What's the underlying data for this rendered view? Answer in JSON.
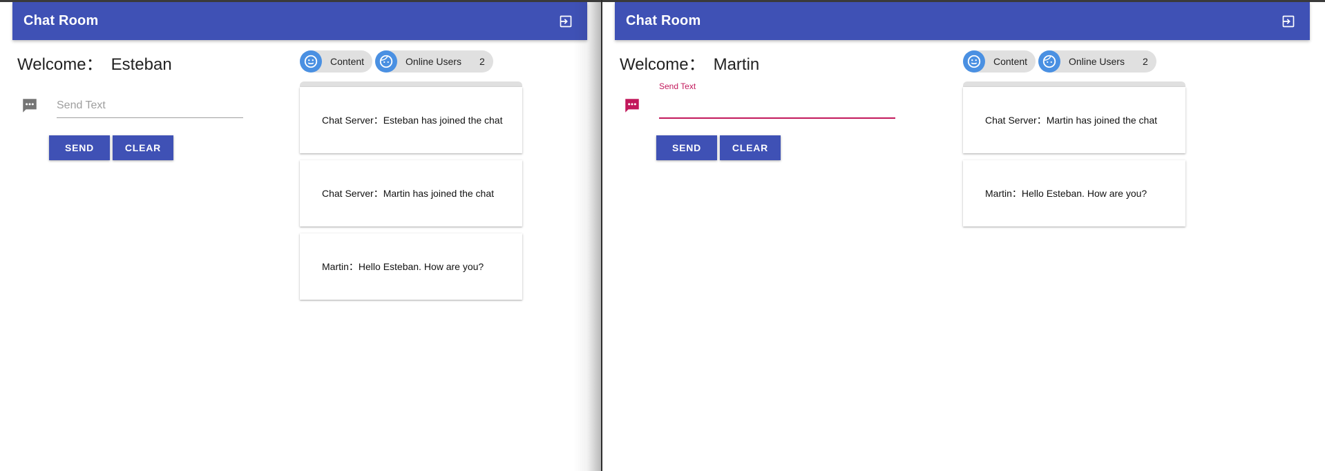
{
  "theme": {
    "primary": "#3f51b5",
    "accent": "#c2185b",
    "chip_bg": "#e0e0e0",
    "avatar": "#4a90e2"
  },
  "windows": [
    {
      "app_title": "Chat Room",
      "exit_icon": "exit-to-app-icon",
      "welcome_label": "Welcome：",
      "username": "Esteban",
      "input": {
        "placeholder": "Send Text",
        "value": "",
        "focused": false
      },
      "send_label": "SEND",
      "clear_label": "CLEAR",
      "content_chip": "Content",
      "online_users_label": "Online Users",
      "online_count": "2",
      "messages": [
        {
          "text": "Chat Server：Esteban has joined the chat"
        },
        {
          "text": "Chat Server：Martin has joined the chat"
        },
        {
          "text": "Martin：Hello Esteban. How are you?"
        }
      ]
    },
    {
      "app_title": "Chat Room",
      "exit_icon": "exit-to-app-icon",
      "welcome_label": "Welcome：",
      "username": "Martin",
      "input": {
        "label": "Send Text",
        "value": "",
        "focused": true
      },
      "send_label": "SEND",
      "clear_label": "CLEAR",
      "content_chip": "Content",
      "online_users_label": "Online Users",
      "online_count": "2",
      "messages": [
        {
          "text": "Chat Server：Martin has joined the chat"
        },
        {
          "text": "Martin：Hello Esteban. How are you?"
        }
      ]
    }
  ]
}
